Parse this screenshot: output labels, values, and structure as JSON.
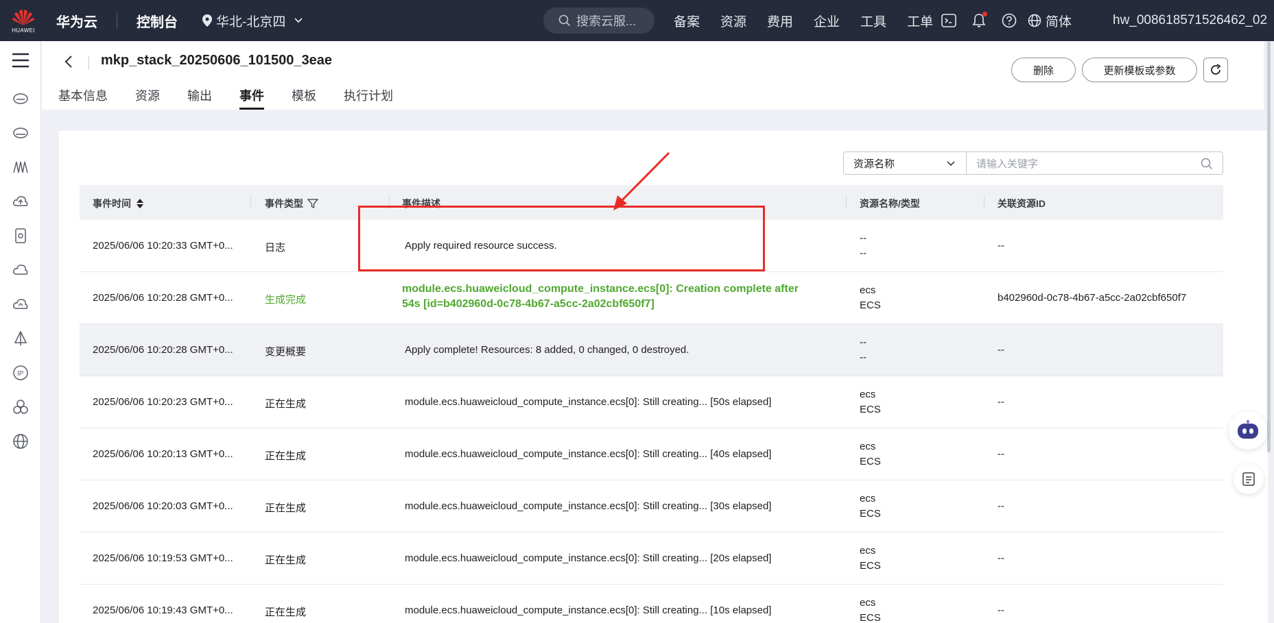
{
  "topbar": {
    "logo_text": "HUAWEI",
    "brand": "华为云",
    "console": "控制台",
    "region": "华北-北京四",
    "search_placeholder": "搜索云服...",
    "nav_links": [
      "备案",
      "资源",
      "费用",
      "企业",
      "工具",
      "工单"
    ],
    "language": "简体",
    "username": "hw_008618571526462_02"
  },
  "header": {
    "back_icon": "chevron-left-icon",
    "stack_name": "mkp_stack_20250606_101500_3eae",
    "tabs": [
      "基本信息",
      "资源",
      "输出",
      "事件",
      "模板",
      "执行计划"
    ],
    "active_tab": "事件",
    "delete_label": "删除",
    "update_label": "更新模板或参数"
  },
  "filter": {
    "select_value": "资源名称",
    "input_placeholder": "请输入关键字"
  },
  "table": {
    "columns": [
      "事件时间",
      "事件类型",
      "事件描述",
      "资源名称/类型",
      "关联资源ID"
    ],
    "rows": [
      {
        "time": "2025/06/06 10:20:33 GMT+0...",
        "type": "日志",
        "desc": "Apply required resource success.",
        "res_name": "--",
        "res_type": "--",
        "resource_id": "--"
      },
      {
        "time": "2025/06/06 10:20:28 GMT+0...",
        "type": "生成完成",
        "desc": "module.ecs.huaweicloud_compute_instance.ecs[0]: Creation complete after 54s [id=b402960d-0c78-4b67-a5cc-2a02cbf650f7]",
        "res_name": "ecs",
        "res_type": "ECS",
        "resource_id": "b402960d-0c78-4b67-a5cc-2a02cbf650f7"
      },
      {
        "time": "2025/06/06 10:20:28 GMT+0...",
        "type": "变更概要",
        "desc": "Apply complete! Resources: 8 added, 0 changed, 0 destroyed.",
        "res_name": "--",
        "res_type": "--",
        "resource_id": "--"
      },
      {
        "time": "2025/06/06 10:20:23 GMT+0...",
        "type": "正在生成",
        "desc": "module.ecs.huaweicloud_compute_instance.ecs[0]: Still creating... [50s elapsed]",
        "res_name": "ecs",
        "res_type": "ECS",
        "resource_id": "--"
      },
      {
        "time": "2025/06/06 10:20:13 GMT+0...",
        "type": "正在生成",
        "desc": "module.ecs.huaweicloud_compute_instance.ecs[0]: Still creating... [40s elapsed]",
        "res_name": "ecs",
        "res_type": "ECS",
        "resource_id": "--"
      },
      {
        "time": "2025/06/06 10:20:03 GMT+0...",
        "type": "正在生成",
        "desc": "module.ecs.huaweicloud_compute_instance.ecs[0]: Still creating... [30s elapsed]",
        "res_name": "ecs",
        "res_type": "ECS",
        "resource_id": "--"
      },
      {
        "time": "2025/06/06 10:19:53 GMT+0...",
        "type": "正在生成",
        "desc": "module.ecs.huaweicloud_compute_instance.ecs[0]: Still creating... [20s elapsed]",
        "res_name": "ecs",
        "res_type": "ECS",
        "resource_id": "--"
      },
      {
        "time": "2025/06/06 10:19:43 GMT+0...",
        "type": "正在生成",
        "desc": "module.ecs.huaweicloud_compute_instance.ecs[0]: Still creating... [10s elapsed]",
        "res_name": "ecs",
        "res_type": "ECS",
        "resource_id": "--"
      }
    ]
  },
  "colors": {
    "topbar_bg": "#252b3a",
    "success_green": "#4fa82f",
    "annotation_red": "#e82b25",
    "notification_dot": "#e6322d"
  }
}
